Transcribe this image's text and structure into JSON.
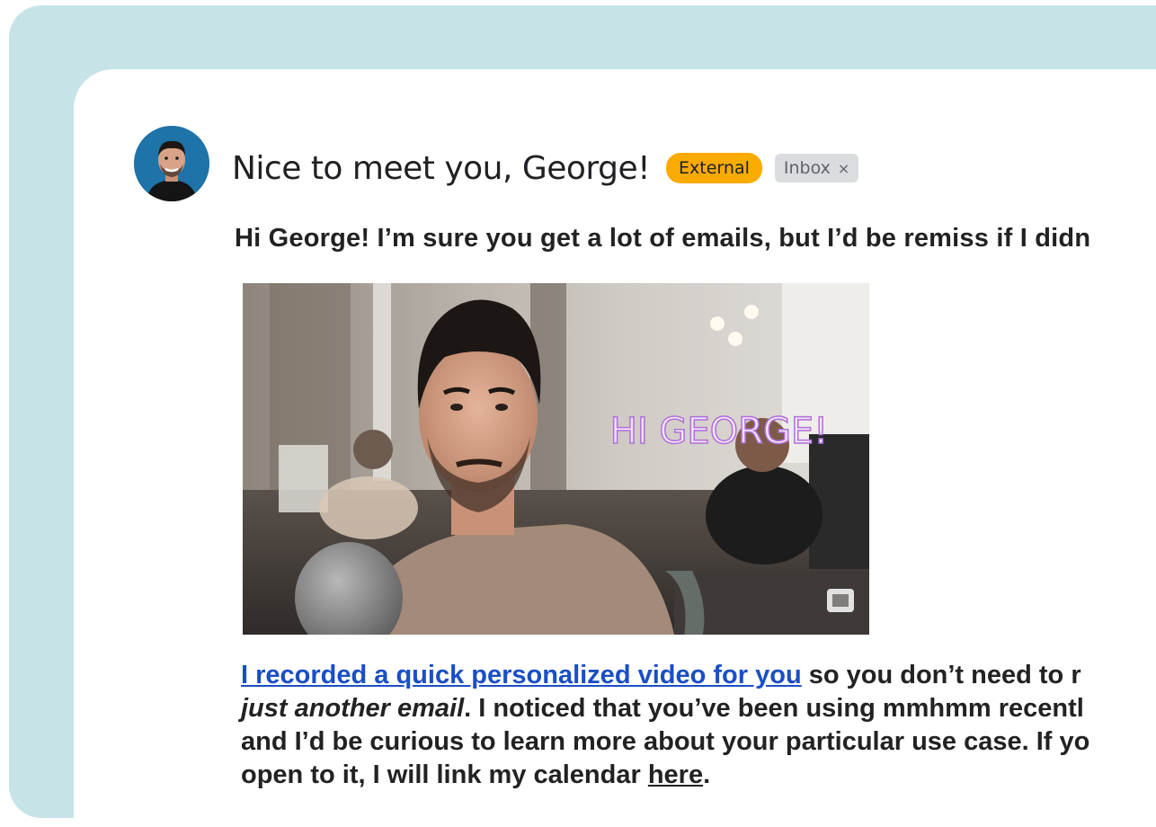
{
  "email": {
    "subject": "Nice to meet you, George!",
    "labels": {
      "external": "External",
      "inbox": "Inbox",
      "inbox_remove": "×"
    },
    "greeting": "Hi George!  I’m sure you get a lot of emails, but I’d be remiss if I didn",
    "video": {
      "overlay_text": "HI GEORGE!"
    },
    "body": {
      "line1_link": "I recorded a quick personalized video for you",
      "line1_rest": " so you don’t need to r",
      "line2_italic": "just another email",
      "line2_rest": ". I noticed that you’ve been using mmhmm recentl",
      "line3": "and I’d be curious to learn more about your particular use case. If yo",
      "line4_pre": "open to it, I will link my calendar ",
      "line4_link": "here",
      "line4_post": "."
    }
  },
  "colors": {
    "frame": "#c6e3e8",
    "external_label": "#f9ab00",
    "inbox_label": "#dadce0",
    "link": "#1a4fc4"
  }
}
